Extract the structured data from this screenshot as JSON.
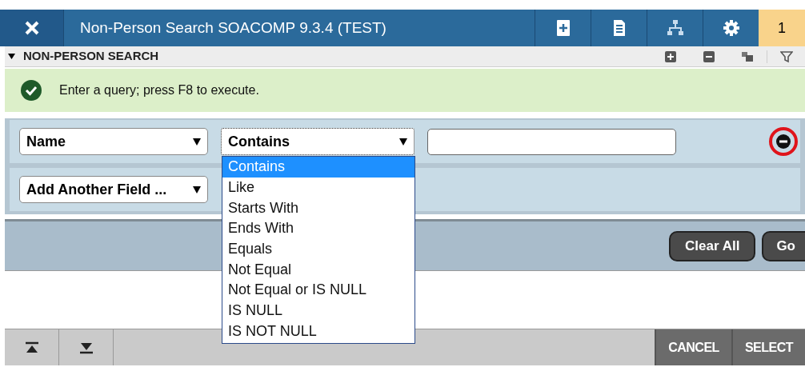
{
  "header": {
    "title": "Non-Person Search SOACOMP 9.3.4 (TEST)",
    "notification_count": "1"
  },
  "section": {
    "title": "NON-PERSON SEARCH",
    "expanded": true
  },
  "message": {
    "text": "Enter a query; press F8 to execute."
  },
  "criteria": [
    {
      "field": "Name",
      "operator": "Contains"
    }
  ],
  "add_field": {
    "label": "Add Another Field ..."
  },
  "operator_options": [
    {
      "label": "Contains",
      "selected": true
    },
    {
      "label": "Like",
      "selected": false
    },
    {
      "label": "Starts With",
      "selected": false
    },
    {
      "label": "Ends With",
      "selected": false
    },
    {
      "label": "Equals",
      "selected": false
    },
    {
      "label": "Not Equal",
      "selected": false
    },
    {
      "label": "Not Equal or IS NULL",
      "selected": false
    },
    {
      "label": "IS NULL",
      "selected": false
    },
    {
      "label": "IS NOT NULL",
      "selected": false
    }
  ],
  "buttons": [
    "Clear All",
    "Go"
  ],
  "footer_buttons": [
    "CANCEL",
    "SELECT"
  ]
}
